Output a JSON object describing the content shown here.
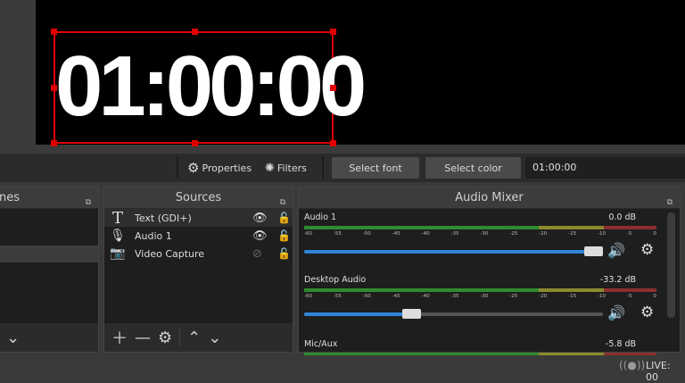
{
  "preview": {
    "text": "01:00:00"
  },
  "toolbar": {
    "properties": "Properties",
    "filters": "Filters",
    "select_font": "Select font",
    "select_color": "Select color",
    "text_value": "01:00:00"
  },
  "scenes": {
    "title": "nes"
  },
  "sources": {
    "title": "Sources",
    "items": [
      {
        "label": "Text (GDI+)",
        "icon": "text-icon",
        "visible": true
      },
      {
        "label": "Audio 1",
        "icon": "microphone-icon",
        "visible": true
      },
      {
        "label": "Video Capture",
        "icon": "camera-icon",
        "visible": false
      }
    ]
  },
  "mixer": {
    "title": "Audio Mixer",
    "ticks": [
      "-60",
      "-55",
      "-50",
      "-45",
      "-40",
      "-35",
      "-30",
      "-25",
      "-20",
      "-15",
      "-10",
      "-5",
      "0"
    ],
    "channels": [
      {
        "name": "Audio 1",
        "db": "0.0 dB",
        "volume_percent": 100
      },
      {
        "name": "Desktop Audio",
        "db": "-33.2 dB",
        "volume_percent": 35
      },
      {
        "name": "Mic/Aux",
        "db": "-5.8 dB"
      }
    ]
  },
  "colors": {
    "meter_green": "#2e8b2e",
    "meter_yellow": "#8b8b2e",
    "meter_red": "#8b2e2e",
    "accent": "#2f85d9",
    "selection": "#e00000"
  },
  "status": {
    "live": "LIVE: 00"
  }
}
